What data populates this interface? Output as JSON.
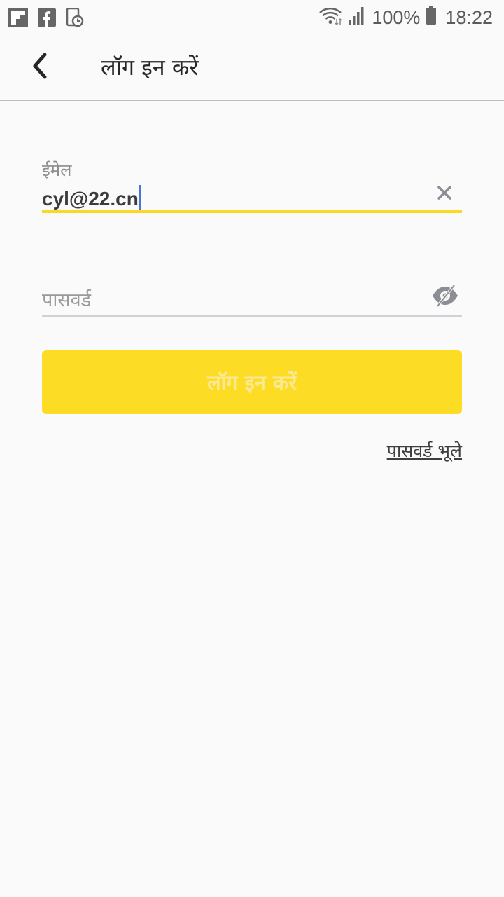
{
  "status_bar": {
    "battery_percent": "100%",
    "time": "18:22",
    "icons": [
      "flipboard-icon",
      "facebook-icon",
      "screen-timer-icon",
      "wifi-icon",
      "signal-icon",
      "battery-icon"
    ]
  },
  "app_bar": {
    "title": "लॉग इन करें",
    "back_icon": "chevron-left-icon"
  },
  "form": {
    "email_label": "ईमेल",
    "email_value": "cyl@22.cn",
    "password_placeholder": "पासवर्ड",
    "login_button_label": "लॉग इन करें",
    "forgot_password_label": "पासवर्ड भूले"
  },
  "colors": {
    "accent": "#fddc25",
    "accent_text": "#fbe995",
    "caret": "#4a74d8",
    "background": "#fafafa"
  }
}
